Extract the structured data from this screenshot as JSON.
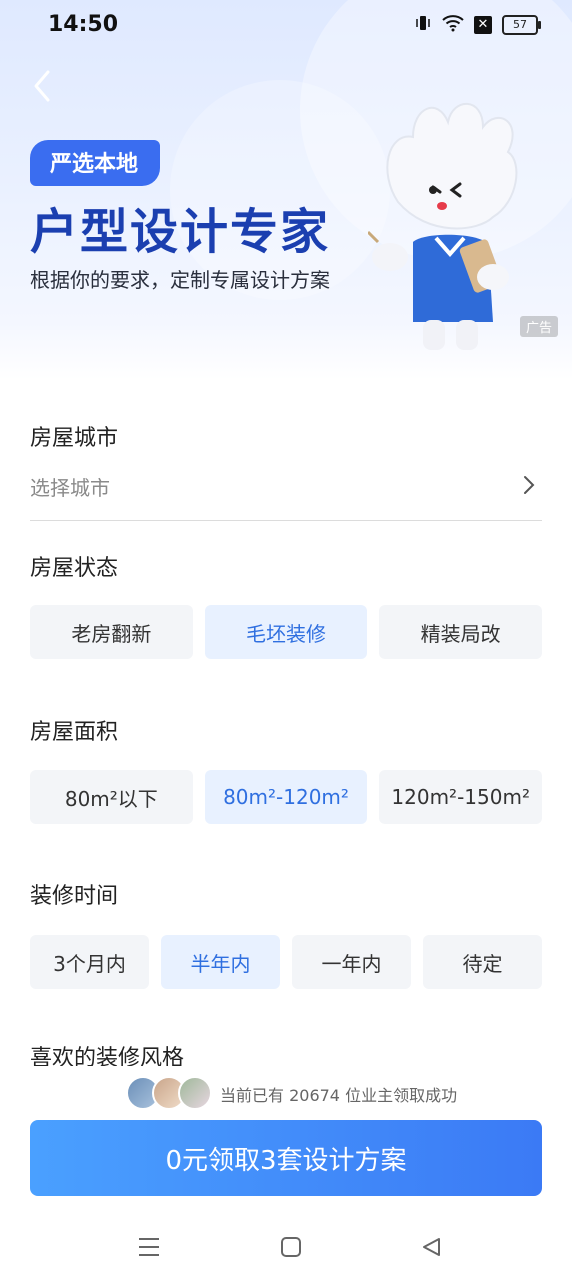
{
  "status_bar": {
    "time": "14:50",
    "battery": "57"
  },
  "banner": {
    "tag": "严选本地",
    "headline": "户型设计专家",
    "subline": "根据你的要求，定制专属设计方案",
    "ad_label": "广告"
  },
  "city": {
    "title": "房屋城市",
    "placeholder": "选择城市"
  },
  "status": {
    "title": "房屋状态",
    "options": [
      "老房翻新",
      "毛坯装修",
      "精装局改"
    ],
    "selected": "毛坯装修"
  },
  "area": {
    "title": "房屋面积",
    "options": [
      "80m²以下",
      "80m²-120m²",
      "120m²-150m²"
    ],
    "selected": "80m²-120m²"
  },
  "time": {
    "title": "装修时间",
    "options": [
      "3个月内",
      "半年内",
      "一年内",
      "待定"
    ],
    "selected": "半年内"
  },
  "style": {
    "title": "喜欢的装修风格"
  },
  "footer": {
    "counter": "当前已有 20674 位业主领取成功",
    "cta": "0元领取3套设计方案"
  },
  "colors": {
    "accent": "#3b7af5",
    "selected_bg": "#e8f1ff",
    "headline": "#1b3fb0"
  }
}
